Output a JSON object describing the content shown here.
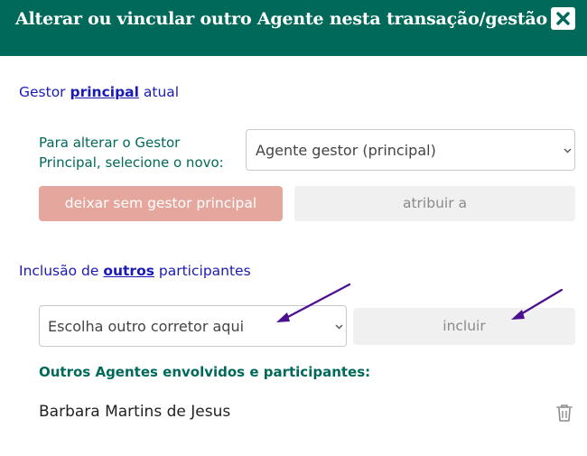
{
  "dialog": {
    "title": "Alterar ou vincular outro Agente nesta transação/gestão",
    "close_icon": "close-icon",
    "colors": {
      "header_bg": "#00695a",
      "section_title": "#1a1ab5",
      "accent_green": "#00695a",
      "danger_button": "#e4a69d",
      "muted_button": "#f0f0f0"
    }
  },
  "main_manager": {
    "title_prefix": "Gestor ",
    "title_emphasis": "principal",
    "title_suffix": " atual",
    "change_label": "Para alterar o Gestor Principal, selecione o novo:",
    "select_value": "Agente gestor (principal)",
    "remove_button": "deixar sem gestor principal",
    "assign_button": "atribuir a"
  },
  "participants": {
    "title_prefix": "Inclusão de ",
    "title_emphasis": "outros",
    "title_suffix": " participantes",
    "select_value": "Escolha outro corretor aqui",
    "include_button": "incluir",
    "list_heading": "Outros Agentes envolvidos e participantes:",
    "items": [
      {
        "name": "Barbara Martins de Jesus",
        "action_icon": "trash-icon"
      }
    ]
  },
  "annotations": {
    "arrow_color": "#4b0f8f",
    "arrows": [
      "arrow-to-select",
      "arrow-to-include"
    ]
  }
}
